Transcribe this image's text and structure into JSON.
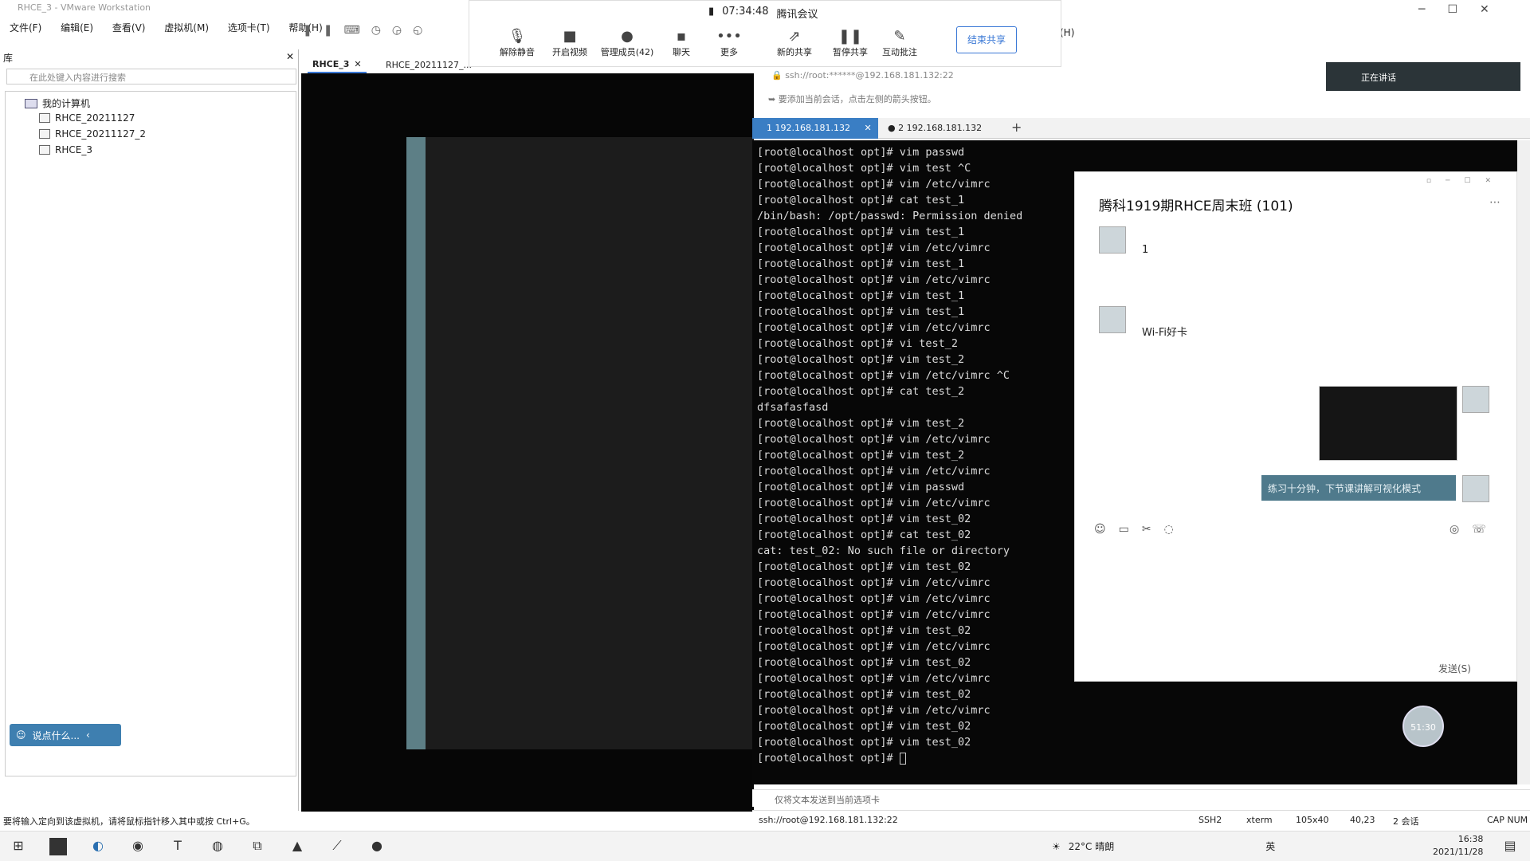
{
  "vmware": {
    "title": "RHCE_3 - VMware Workstation",
    "menu": [
      "文件(F)",
      "编辑(E)",
      "查看(V)",
      "虚拟机(M)",
      "选项卡(T)",
      "帮助(H)"
    ],
    "library_label": "库",
    "search_placeholder": "在此处键入内容进行搜索",
    "tree_root": "我的计算机",
    "tree_items": [
      "RHCE_20211127",
      "RHCE_20211127_2",
      "RHCE_3"
    ],
    "tabs": [
      "RHCE_3",
      "RHCE_20211127_..."
    ],
    "say_button": "说点什么...",
    "status_text": "要将输入定向到该虚拟机，请将鼠标指针移入其中或按 Ctrl+G。",
    "menu_extra": "(H)"
  },
  "meeting": {
    "time": "07:34:48",
    "app_name": "腾讯会议",
    "buttons": [
      {
        "label": "解除静音",
        "icon": "microphone-icon"
      },
      {
        "label": "开启视频",
        "icon": "camera-icon"
      },
      {
        "label": "管理成员(42)",
        "icon": "people-icon"
      },
      {
        "label": "聊天",
        "icon": "chat-icon"
      },
      {
        "label": "更多",
        "icon": "more-icon"
      },
      {
        "label": "新的共享",
        "icon": "share-icon"
      },
      {
        "label": "暂停共享",
        "icon": "pause-icon"
      },
      {
        "label": "互动批注",
        "icon": "annotate-icon"
      }
    ],
    "end_share": "结束共享",
    "speaking": "正在讲话"
  },
  "xshell": {
    "address": "ssh://root:******@192.168.181.132:22",
    "hint": "要添加当前会话，点击左侧的箭头按钮。",
    "tabs": [
      "1 192.168.181.132",
      "2 192.168.181.132"
    ],
    "terminal_lines": [
      "[root@localhost opt]# vim passwd",
      "[root@localhost opt]# vim test ^C",
      "[root@localhost opt]# vim /etc/vimrc",
      "[root@localhost opt]# cat test_1",
      "",
      "/bin/bash: /opt/passwd: Permission denied",
      "[root@localhost opt]# vim test_1",
      "[root@localhost opt]# vim /etc/vimrc",
      "[root@localhost opt]# vim test_1",
      "[root@localhost opt]# vim /etc/vimrc",
      "[root@localhost opt]# vim test_1",
      "[root@localhost opt]# vim test_1",
      "[root@localhost opt]# vim /etc/vimrc",
      "[root@localhost opt]# vi test_2",
      "[root@localhost opt]# vim test_2",
      "[root@localhost opt]# vim /etc/vimrc ^C",
      "[root@localhost opt]# cat test_2",
      "dfsafasfasd",
      "[root@localhost opt]# vim test_2",
      "[root@localhost opt]# vim /etc/vimrc",
      "[root@localhost opt]# vim test_2",
      "[root@localhost opt]# vim /etc/vimrc",
      "[root@localhost opt]# vim passwd",
      "[root@localhost opt]# vim /etc/vimrc",
      "[root@localhost opt]# vim test_02",
      "[root@localhost opt]# cat test_02",
      "cat: test_02: No such file or directory",
      "[root@localhost opt]# vim test_02",
      "[root@localhost opt]# vim /etc/vimrc",
      "[root@localhost opt]# vim /etc/vimrc",
      "[root@localhost opt]# vim /etc/vimrc",
      "[root@localhost opt]# vim test_02",
      "[root@localhost opt]# vim /etc/vimrc",
      "[root@localhost opt]# vim test_02",
      "[root@localhost opt]# vim /etc/vimrc",
      "[root@localhost opt]# vim test_02",
      "[root@localhost opt]# vim /etc/vimrc",
      "[root@localhost opt]# vim test_02",
      "[root@localhost opt]# vim test_02",
      "[root@localhost opt]# "
    ],
    "input_hint": "仅将文本发送到当前选项卡",
    "status": {
      "address": "ssh://root@192.168.181.132:22",
      "protocol": "SSH2",
      "term": "xterm",
      "size": "105x40",
      "cursor": "40,23",
      "sessions": "2 会话",
      "caps": "CAP NUM"
    }
  },
  "chat": {
    "title": "腾科1919期RHCE周末班 (101)",
    "msg1": "1",
    "msg2": "Wi-Fi好卡",
    "bubble": "练习十分钟，下节课讲解可视化模式",
    "send": "发送(S)",
    "timer": "51:30"
  },
  "taskbar": {
    "weather": "22°C 晴朗",
    "ime": "英",
    "time": "16:38",
    "date": "2021/11/28"
  }
}
